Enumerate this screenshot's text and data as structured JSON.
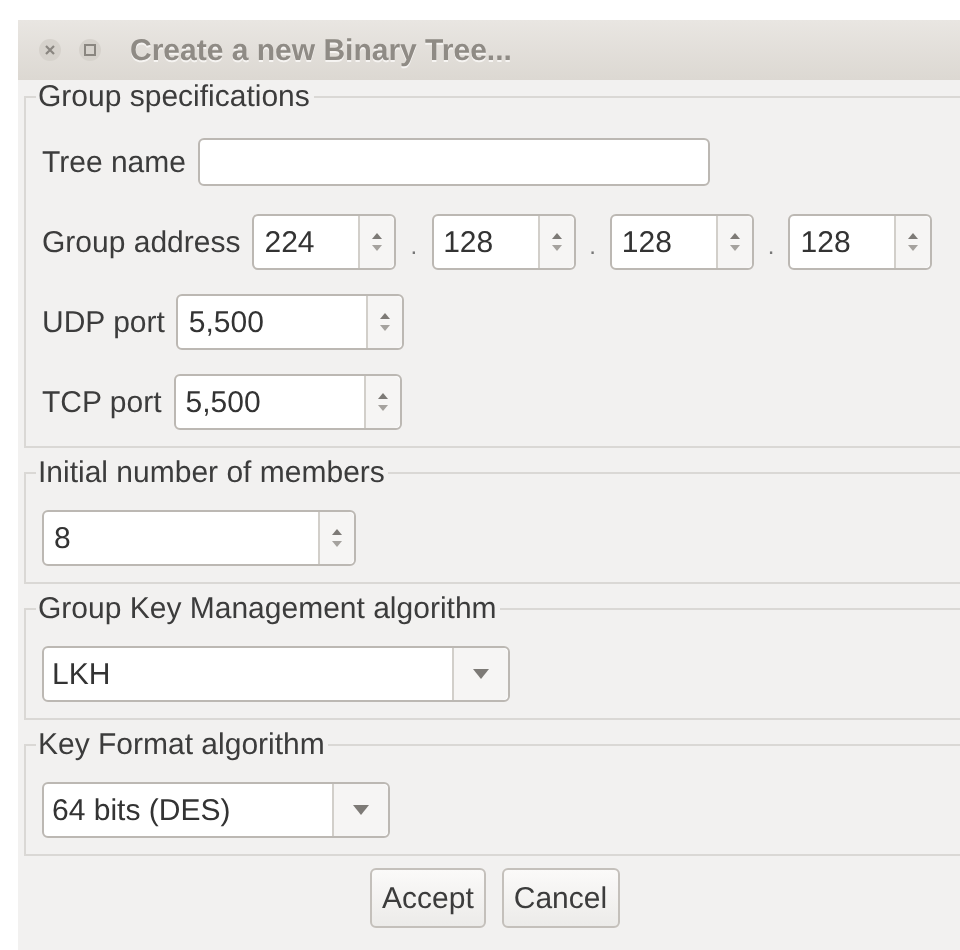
{
  "window": {
    "title": "Create a new Binary Tree..."
  },
  "sections": [
    {
      "legend": "Group specifications",
      "rows": [
        {
          "kind": "text",
          "label": "Tree name"
        },
        {
          "kind": "address",
          "label": "Group address",
          "separator": ".",
          "octets": [
            "224",
            "128",
            "128",
            "128"
          ]
        },
        {
          "kind": "spinner",
          "label": "UDP port",
          "value": "5,500"
        },
        {
          "kind": "spinner",
          "label": "TCP port",
          "value": "5,500"
        }
      ]
    },
    {
      "legend": "Initial number of members",
      "rows": [
        {
          "kind": "spinner",
          "value": "8"
        }
      ]
    },
    {
      "legend": "Group Key Management algorithm",
      "rows": [
        {
          "kind": "combo",
          "value": "LKH"
        }
      ]
    },
    {
      "legend": "Key Format algorithm",
      "rows": [
        {
          "kind": "combo",
          "value": "64 bits (DES)"
        }
      ]
    }
  ],
  "buttons": [
    "Accept",
    "Cancel"
  ]
}
